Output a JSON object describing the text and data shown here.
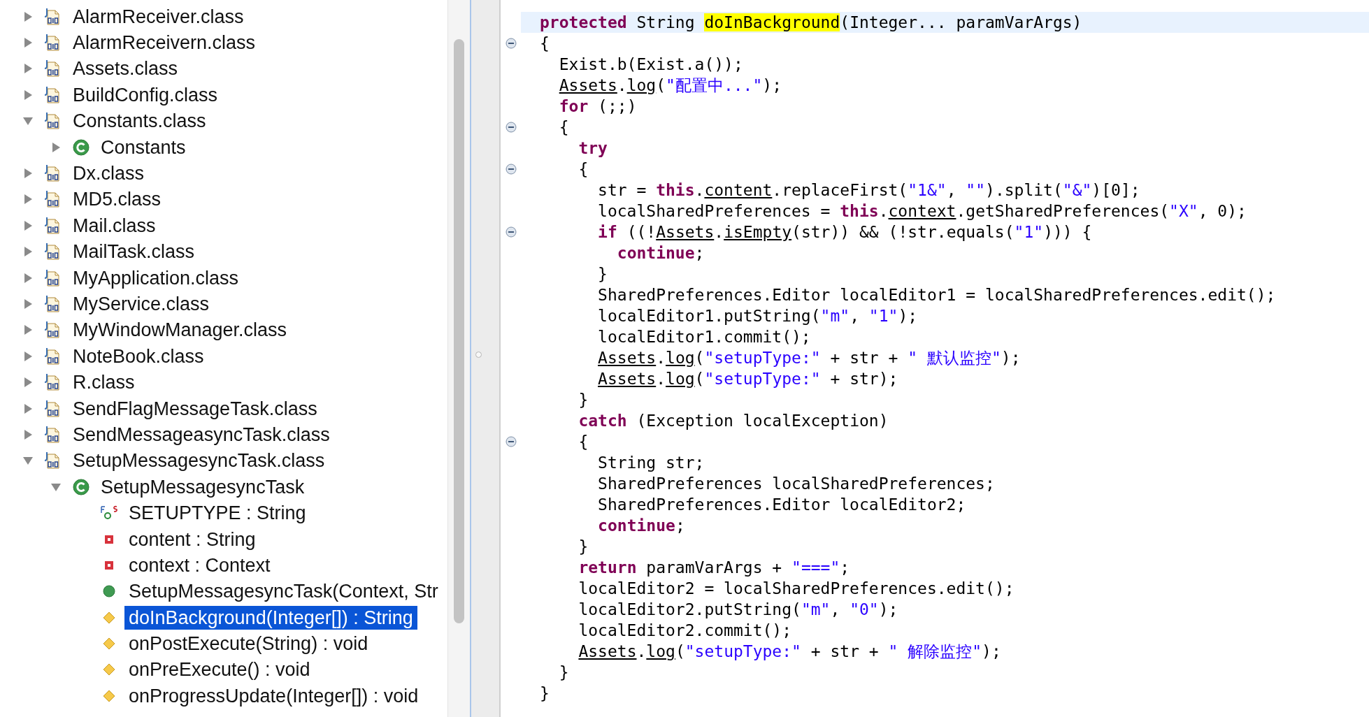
{
  "outline": {
    "items": [
      {
        "label": "AlarmReceiver.class",
        "kind": "classfile",
        "expanded": false,
        "selected": false
      },
      {
        "label": "AlarmReceivern.class",
        "kind": "classfile",
        "expanded": false,
        "selected": false
      },
      {
        "label": "Assets.class",
        "kind": "classfile",
        "expanded": false,
        "selected": false
      },
      {
        "label": "BuildConfig.class",
        "kind": "classfile",
        "expanded": false,
        "selected": false
      },
      {
        "label": "Constants.class",
        "kind": "classfile",
        "expanded": true,
        "selected": false,
        "children": [
          {
            "label": "Constants",
            "kind": "class",
            "expanded": false,
            "selected": false
          }
        ]
      },
      {
        "label": "Dx.class",
        "kind": "classfile",
        "expanded": false,
        "selected": false
      },
      {
        "label": "MD5.class",
        "kind": "classfile",
        "expanded": false,
        "selected": false
      },
      {
        "label": "Mail.class",
        "kind": "classfile",
        "expanded": false,
        "selected": false
      },
      {
        "label": "MailTask.class",
        "kind": "classfile",
        "expanded": false,
        "selected": false
      },
      {
        "label": "MyApplication.class",
        "kind": "classfile",
        "expanded": false,
        "selected": false
      },
      {
        "label": "MyService.class",
        "kind": "classfile",
        "expanded": false,
        "selected": false
      },
      {
        "label": "MyWindowManager.class",
        "kind": "classfile",
        "expanded": false,
        "selected": false
      },
      {
        "label": "NoteBook.class",
        "kind": "classfile",
        "expanded": false,
        "selected": false
      },
      {
        "label": "R.class",
        "kind": "classfile",
        "expanded": false,
        "selected": false
      },
      {
        "label": "SendFlagMessageTask.class",
        "kind": "classfile",
        "expanded": false,
        "selected": false
      },
      {
        "label": "SendMessageasyncTask.class",
        "kind": "classfile",
        "expanded": false,
        "selected": false
      },
      {
        "label": "SetupMessagesyncTask.class",
        "kind": "classfile",
        "expanded": true,
        "selected": false,
        "children": [
          {
            "label": "SetupMessagesyncTask",
            "kind": "class",
            "expanded": true,
            "selected": false,
            "children": [
              {
                "label": "SETUPTYPE : String",
                "kind": "static-field",
                "selected": false
              },
              {
                "label": "content : String",
                "kind": "private-field",
                "selected": false
              },
              {
                "label": "context : Context",
                "kind": "private-field",
                "selected": false
              },
              {
                "label": "SetupMessagesyncTask(Context, Str",
                "kind": "constructor",
                "selected": false
              },
              {
                "label": "doInBackground(Integer[]) : String",
                "kind": "method",
                "selected": true
              },
              {
                "label": "onPostExecute(String) : void",
                "kind": "method",
                "selected": false
              },
              {
                "label": "onPreExecute() : void",
                "kind": "method",
                "selected": false
              },
              {
                "label": "onProgressUpdate(Integer[]) : void",
                "kind": "method",
                "selected": false
              }
            ]
          }
        ]
      }
    ]
  },
  "editor": {
    "lines": [
      {
        "fold": false,
        "current": true,
        "tokens": [
          {
            "text": "protected",
            "kind": "keyword"
          },
          {
            "text": " String ",
            "kind": "plain"
          },
          {
            "text": "doInBackground",
            "kind": "match"
          },
          {
            "text": "(Integer... paramVarArgs)",
            "kind": "plain"
          }
        ]
      },
      {
        "fold": true,
        "current": false,
        "tokens": [
          {
            "text": "{",
            "kind": "plain"
          }
        ]
      },
      {
        "fold": false,
        "current": false,
        "tokens": [
          {
            "text": "  Exist.b(Exist.a());",
            "kind": "plain"
          }
        ]
      },
      {
        "fold": false,
        "current": false,
        "tokens": [
          {
            "text": "  Assets",
            "kind": "reference"
          },
          {
            "text": ".",
            "kind": "plain"
          },
          {
            "text": "log",
            "kind": "reference"
          },
          {
            "text": "(",
            "kind": "plain"
          },
          {
            "text": "\"配置中...\"",
            "kind": "string"
          },
          {
            "text": ");",
            "kind": "plain"
          }
        ]
      },
      {
        "fold": false,
        "current": false,
        "tokens": [
          {
            "text": "  for",
            "kind": "keyword"
          },
          {
            "text": " (;;)",
            "kind": "plain"
          }
        ]
      },
      {
        "fold": true,
        "current": false,
        "tokens": [
          {
            "text": "  {",
            "kind": "plain"
          }
        ]
      },
      {
        "fold": false,
        "current": false,
        "tokens": [
          {
            "text": "    try",
            "kind": "keyword"
          }
        ]
      },
      {
        "fold": true,
        "current": false,
        "tokens": [
          {
            "text": "    {",
            "kind": "plain"
          }
        ]
      },
      {
        "fold": false,
        "current": false,
        "tokens": [
          {
            "text": "      str = ",
            "kind": "plain"
          },
          {
            "text": "this",
            "kind": "keyword"
          },
          {
            "text": ".",
            "kind": "plain"
          },
          {
            "text": "content",
            "kind": "reference"
          },
          {
            "text": ".replaceFirst(",
            "kind": "plain"
          },
          {
            "text": "\"1&\"",
            "kind": "string"
          },
          {
            "text": ", ",
            "kind": "plain"
          },
          {
            "text": "\"\"",
            "kind": "string"
          },
          {
            "text": ").split(",
            "kind": "plain"
          },
          {
            "text": "\"&\"",
            "kind": "string"
          },
          {
            "text": ")[0];",
            "kind": "plain"
          }
        ]
      },
      {
        "fold": false,
        "current": false,
        "tokens": [
          {
            "text": "      localSharedPreferences = ",
            "kind": "plain"
          },
          {
            "text": "this",
            "kind": "keyword"
          },
          {
            "text": ".",
            "kind": "plain"
          },
          {
            "text": "context",
            "kind": "reference"
          },
          {
            "text": ".getSharedPreferences(",
            "kind": "plain"
          },
          {
            "text": "\"X\"",
            "kind": "string"
          },
          {
            "text": ", 0);",
            "kind": "plain"
          }
        ]
      },
      {
        "fold": true,
        "current": false,
        "tokens": [
          {
            "text": "      if",
            "kind": "keyword"
          },
          {
            "text": " ((!",
            "kind": "plain"
          },
          {
            "text": "Assets",
            "kind": "reference"
          },
          {
            "text": ".",
            "kind": "plain"
          },
          {
            "text": "isEmpty",
            "kind": "reference"
          },
          {
            "text": "(str)) && (!str.equals(",
            "kind": "plain"
          },
          {
            "text": "\"1\"",
            "kind": "string"
          },
          {
            "text": "))) {",
            "kind": "plain"
          }
        ]
      },
      {
        "fold": false,
        "current": false,
        "tokens": [
          {
            "text": "        continue",
            "kind": "keyword"
          },
          {
            "text": ";",
            "kind": "plain"
          }
        ]
      },
      {
        "fold": false,
        "current": false,
        "tokens": [
          {
            "text": "      }",
            "kind": "plain"
          }
        ]
      },
      {
        "fold": false,
        "current": false,
        "tokens": [
          {
            "text": "      SharedPreferences.Editor localEditor1 = localSharedPreferences.edit();",
            "kind": "plain"
          }
        ]
      },
      {
        "fold": false,
        "current": false,
        "tokens": [
          {
            "text": "      localEditor1.putString(",
            "kind": "plain"
          },
          {
            "text": "\"m\"",
            "kind": "string"
          },
          {
            "text": ", ",
            "kind": "plain"
          },
          {
            "text": "\"1\"",
            "kind": "string"
          },
          {
            "text": ");",
            "kind": "plain"
          }
        ]
      },
      {
        "fold": false,
        "current": false,
        "tokens": [
          {
            "text": "      localEditor1.commit();",
            "kind": "plain"
          }
        ]
      },
      {
        "fold": false,
        "current": false,
        "tokens": [
          {
            "text": "      Assets",
            "kind": "reference"
          },
          {
            "text": ".",
            "kind": "plain"
          },
          {
            "text": "log",
            "kind": "reference"
          },
          {
            "text": "(",
            "kind": "plain"
          },
          {
            "text": "\"setupType:\"",
            "kind": "string"
          },
          {
            "text": " + str + ",
            "kind": "plain"
          },
          {
            "text": "\" 默认监控\"",
            "kind": "string"
          },
          {
            "text": ");",
            "kind": "plain"
          }
        ]
      },
      {
        "fold": false,
        "current": false,
        "tokens": [
          {
            "text": "      Assets",
            "kind": "reference"
          },
          {
            "text": ".",
            "kind": "plain"
          },
          {
            "text": "log",
            "kind": "reference"
          },
          {
            "text": "(",
            "kind": "plain"
          },
          {
            "text": "\"setupType:\"",
            "kind": "string"
          },
          {
            "text": " + str);",
            "kind": "plain"
          }
        ]
      },
      {
        "fold": false,
        "current": false,
        "tokens": [
          {
            "text": "    }",
            "kind": "plain"
          }
        ]
      },
      {
        "fold": false,
        "current": false,
        "tokens": [
          {
            "text": "    catch",
            "kind": "keyword"
          },
          {
            "text": " (Exception localException)",
            "kind": "plain"
          }
        ]
      },
      {
        "fold": true,
        "current": false,
        "tokens": [
          {
            "text": "    {",
            "kind": "plain"
          }
        ]
      },
      {
        "fold": false,
        "current": false,
        "tokens": [
          {
            "text": "      String str;",
            "kind": "plain"
          }
        ]
      },
      {
        "fold": false,
        "current": false,
        "tokens": [
          {
            "text": "      SharedPreferences localSharedPreferences;",
            "kind": "plain"
          }
        ]
      },
      {
        "fold": false,
        "current": false,
        "tokens": [
          {
            "text": "      SharedPreferences.Editor localEditor2;",
            "kind": "plain"
          }
        ]
      },
      {
        "fold": false,
        "current": false,
        "tokens": [
          {
            "text": "      continue",
            "kind": "keyword"
          },
          {
            "text": ";",
            "kind": "plain"
          }
        ]
      },
      {
        "fold": false,
        "current": false,
        "tokens": [
          {
            "text": "    }",
            "kind": "plain"
          }
        ]
      },
      {
        "fold": false,
        "current": false,
        "tokens": [
          {
            "text": "    return",
            "kind": "keyword"
          },
          {
            "text": " paramVarArgs + ",
            "kind": "plain"
          },
          {
            "text": "\"===\"",
            "kind": "string"
          },
          {
            "text": ";",
            "kind": "plain"
          }
        ]
      },
      {
        "fold": false,
        "current": false,
        "tokens": [
          {
            "text": "    localEditor2 = localSharedPreferences.edit();",
            "kind": "plain"
          }
        ]
      },
      {
        "fold": false,
        "current": false,
        "tokens": [
          {
            "text": "    localEditor2.putString(",
            "kind": "plain"
          },
          {
            "text": "\"m\"",
            "kind": "string"
          },
          {
            "text": ", ",
            "kind": "plain"
          },
          {
            "text": "\"0\"",
            "kind": "string"
          },
          {
            "text": ");",
            "kind": "plain"
          }
        ]
      },
      {
        "fold": false,
        "current": false,
        "tokens": [
          {
            "text": "    localEditor2.commit();",
            "kind": "plain"
          }
        ]
      },
      {
        "fold": false,
        "current": false,
        "tokens": [
          {
            "text": "    Assets",
            "kind": "reference"
          },
          {
            "text": ".",
            "kind": "plain"
          },
          {
            "text": "log",
            "kind": "reference"
          },
          {
            "text": "(",
            "kind": "plain"
          },
          {
            "text": "\"setupType:\"",
            "kind": "string"
          },
          {
            "text": " + str + ",
            "kind": "plain"
          },
          {
            "text": "\" 解除监控\"",
            "kind": "string"
          },
          {
            "text": ");",
            "kind": "plain"
          }
        ]
      },
      {
        "fold": false,
        "current": false,
        "tokens": [
          {
            "text": "  }",
            "kind": "plain"
          }
        ]
      },
      {
        "fold": false,
        "current": false,
        "tokens": [
          {
            "text": "}",
            "kind": "plain"
          }
        ]
      }
    ]
  }
}
